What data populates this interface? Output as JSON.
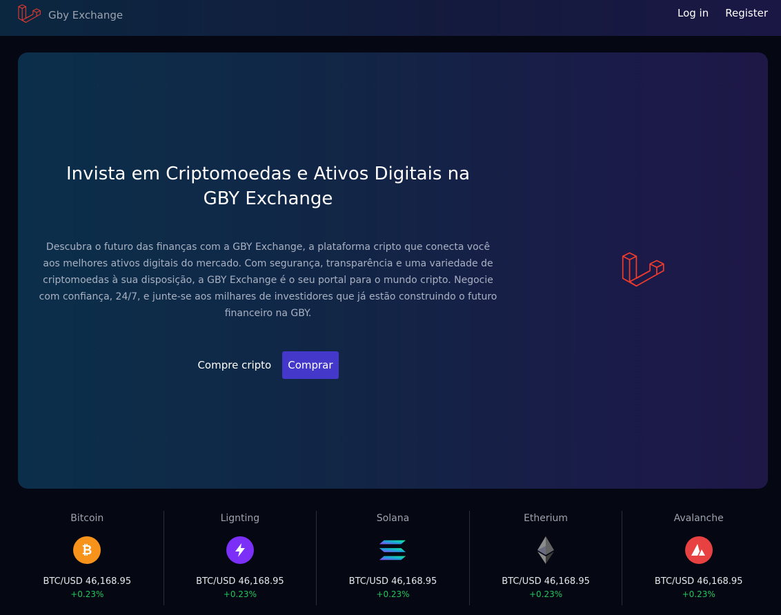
{
  "header": {
    "brand_name": "Gby Exchange",
    "login_label": "Log in",
    "register_label": "Register"
  },
  "hero": {
    "title": "Invista em Criptomoedas e Ativos Digitais na GBY Exchange",
    "description": "Descubra o futuro das finanças com a GBY Exchange, a plataforma cripto que conecta você aos melhores ativos digitais do mercado. Com segurança, transparência e uma variedade de criptomoedas à sua disposição, a GBY Exchange é o seu portal para o mundo cripto. Negocie com confiança, 24/7, e junte-se aos milhares de investidores que já estão construindo o futuro financeiro na GBY.",
    "buy_text": "Compre cripto",
    "buy_button": "Comprar"
  },
  "tickers": [
    {
      "name": "Bitcoin",
      "icon": "bitcoin-icon",
      "color": "#f7931a",
      "price": "BTC/USD 46,168.95",
      "change": "+0.23%"
    },
    {
      "name": "Lignting",
      "icon": "lightning-icon",
      "color": "#7b2ff7",
      "price": "BTC/USD 46,168.95",
      "change": "+0.23%"
    },
    {
      "name": "Solana",
      "icon": "solana-icon",
      "color": "#14f195",
      "price": "BTC/USD 46,168.95",
      "change": "+0.23%"
    },
    {
      "name": "Etherium",
      "icon": "ethereum-icon",
      "color": "#8c8c8c",
      "price": "BTC/USD 46,168.95",
      "change": "+0.23%"
    },
    {
      "name": "Avalanche",
      "icon": "avalanche-icon",
      "color": "#e84142",
      "price": "BTC/USD 46,168.95",
      "change": "+0.23%"
    }
  ],
  "colors": {
    "accent": "#4338ca",
    "positive": "#22c55e",
    "logo_red": "#ef3b2d"
  }
}
